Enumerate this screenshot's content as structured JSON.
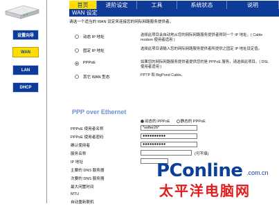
{
  "nav_tabs": [
    "首页",
    "进阶设定",
    "工具",
    "系统状态",
    "说明"
  ],
  "sidebar": {
    "items": [
      "设置向导",
      "WAN",
      "LAN",
      "DHCP"
    ]
  },
  "page_title": "WAN 设定",
  "intro": "请选一个适当的 WAN 设定来连接您的网际网路服务提供者。",
  "options": [
    {
      "label": "动态 IP 地址",
      "desc": "选择此项目会自动地从您的网际网路服务提供者得到一个 IP 地址。( Cable modem 使用者适用 )",
      "selected": false
    },
    {
      "label": "固定 IP 地址",
      "desc": "选择此项目请输入您的网际网路服务提供者所提供之固定 IP 地址设定值。",
      "selected": false
    },
    {
      "label": "PPPoE",
      "desc": "如果您的网际网路服务提供者提供您的是 PPPoE 服务，请选择此项目。( DSL 使用者适用 )",
      "selected": true
    },
    {
      "label": "其它 WAN 型态",
      "desc": "PPTP 和 BigPond Cable。",
      "selected": false
    }
  ],
  "ppp_title": "PPP over Ethernet",
  "mode": {
    "dynamic": "动态的 PPPoE",
    "static": "静态的 PPPoE"
  },
  "fields": [
    {
      "label": "PPPoE 使用者名称",
      "value": "*softer26*"
    },
    {
      "label": "PPPoE 使用者密码",
      "value": "●●●●●●●●●●"
    },
    {
      "label": "确认使用者",
      "value": "●●●●●●●●●●"
    },
    {
      "label": "服务名称",
      "value": "",
      "suffix": "(可不填)"
    },
    {
      "label": "IP 地址",
      "value": ""
    },
    {
      "label": "主要的 DNS 服务器",
      "value": ""
    },
    {
      "label": "次要的 DNS 服务器",
      "value": ""
    },
    {
      "label": "最大闲置时间",
      "value": ""
    },
    {
      "label": "MTU",
      "value": ""
    },
    {
      "label": "自动重新联机",
      "value": ""
    }
  ],
  "logo": {
    "main": "PConline",
    "dotcom": ".com.cn",
    "cn": "太平洋电脑网"
  }
}
